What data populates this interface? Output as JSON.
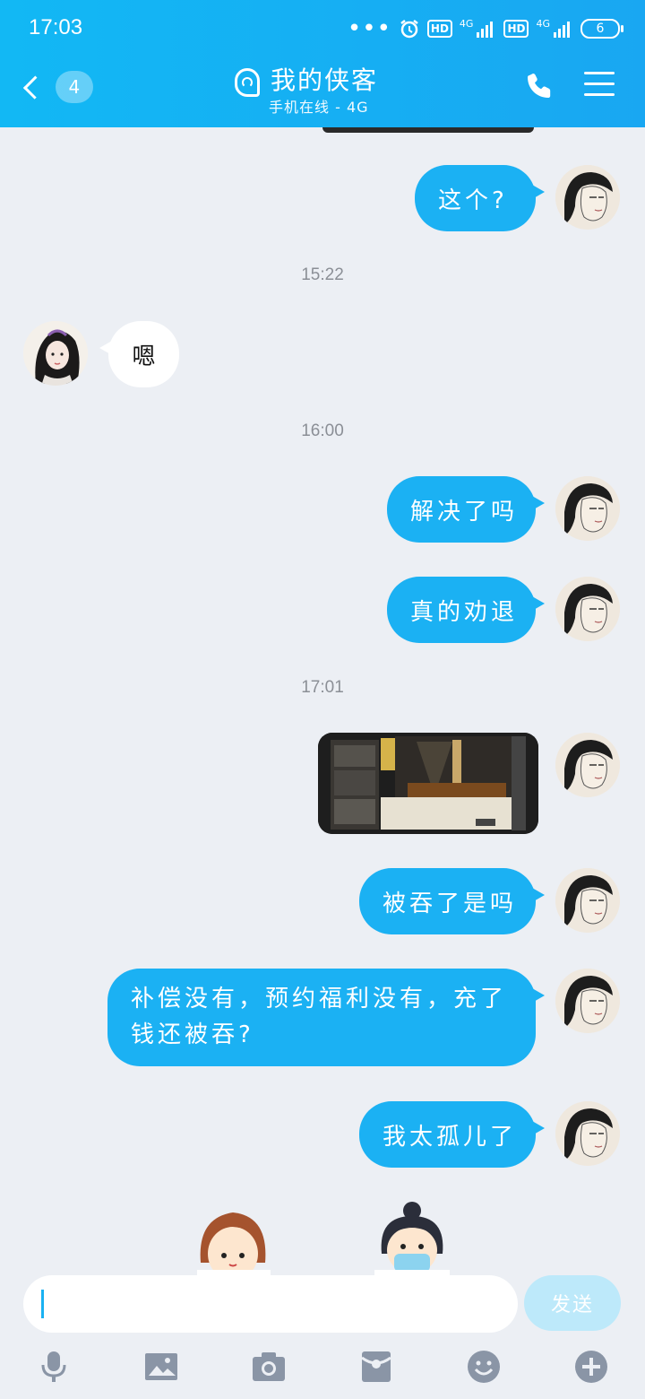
{
  "status": {
    "time": "17:03",
    "dots": "•••",
    "hd1": "HD",
    "net1": "4G",
    "hd2": "HD",
    "net2": "4G",
    "battery": "6"
  },
  "header": {
    "unread_count": "4",
    "title": "我的侠客",
    "subtitle": "手机在线 - 4G",
    "phone_icon": "phone-icon",
    "menu_icon": "menu-icon"
  },
  "messages": {
    "m1": "这个?",
    "t1": "15:22",
    "m2": "嗯",
    "t2": "16:00",
    "m3": "解决了吗",
    "m4": "真的劝退",
    "t3": "17:01",
    "m5": "被吞了是吗",
    "m6": "补偿没有，预约福利没有，充了钱还被吞?",
    "m7": "我太孤儿了"
  },
  "composer": {
    "send_label": "发送"
  },
  "colors": {
    "header": "#12b8f4",
    "bubble_out": "#1bb1f3",
    "bubble_in": "#ffffff",
    "background": "#eceff4"
  }
}
